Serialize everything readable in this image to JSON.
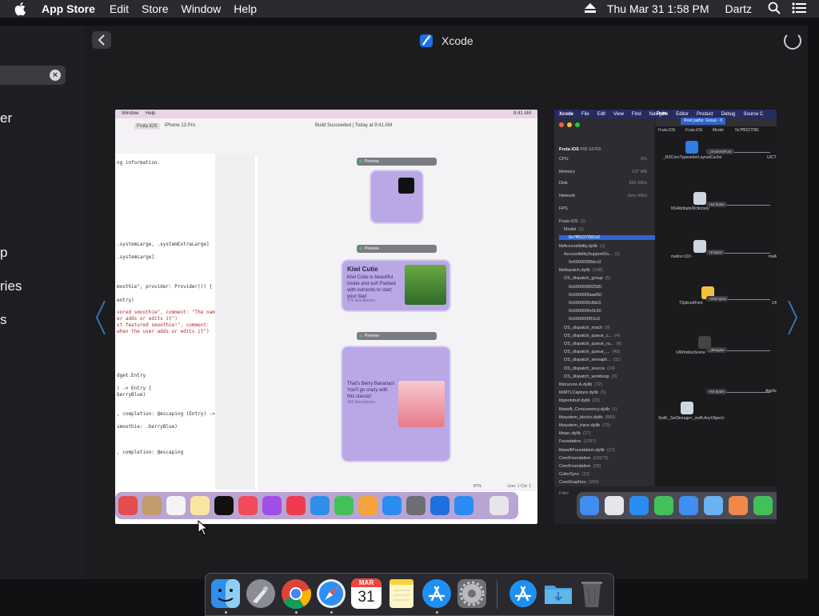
{
  "menubar": {
    "app_name": "App Store",
    "menus": [
      "Edit",
      "Store",
      "Window",
      "Help"
    ],
    "datetime": "Thu Mar 31  1:58 PM",
    "user": "Dartz",
    "icons": [
      "apple-icon",
      "eject-icon",
      "search-icon",
      "control-center-icon"
    ]
  },
  "sidebar": {
    "fragments": [
      "er",
      "p",
      "ries",
      "s"
    ]
  },
  "window": {
    "title": "Xcode"
  },
  "card1": {
    "menu_items": [
      "Window",
      "Help"
    ],
    "time": "9:41 AM",
    "breadcrumb": [
      "Fruta iOS",
      "iPhone 13 Pro"
    ],
    "build_status": "Build Succeeded | Today at 9:41 AM",
    "code_lines": [
      "ng information.",
      ".systemLarge, .systemExtraLarge]",
      ".systemLarge]",
      "moothie\", provider: Provider()) {",
      "entry)",
      "vored smoothie\", comment: \"The name",
      "er adds or edits it\")",
      "st featured smoothie!\", comment:",
      "when the user adds or edits it\")",
      "dget.Entry",
      ") -> Entry {",
      "berryBlue)",
      ", completion: @escaping (Entry) ->",
      "smoothie: .berryBlue)",
      ", completion: @escaping"
    ],
    "preview_label": "Preview",
    "widgets": [
      {
        "title": "Kiwi Cutie",
        "desc": "Kiwi Cutie is beautiful inside and out! Packed with nutrients to start your day!",
        "cal": "170 kilocalories"
      },
      {
        "title": "",
        "desc": "That's Berry Bananas! You'll go crazy with this classic!",
        "cal": "150 kilocalories"
      }
    ],
    "zoom": "87%",
    "cursor_pos": "Line: 1  Col: 1"
  },
  "card2": {
    "menu_items": [
      "Xcode",
      "File",
      "Edit",
      "View",
      "Find",
      "Navigate",
      "Editor",
      "Product",
      "Debug",
      "Source C"
    ],
    "scheme": "Fruta",
    "scheme_sub": "Fruta",
    "tab": "Root paths: Group - 0",
    "path": [
      "Fruta iOS",
      "Fruta iOS",
      "Model",
      "0x7ff5227081"
    ],
    "process": {
      "name": "Fruta iOS",
      "pid": "PID 14769"
    },
    "gauges": [
      {
        "name": "CPU",
        "value": "0%"
      },
      {
        "name": "Memory",
        "value": "137 MB"
      },
      {
        "name": "Disk",
        "value": "562 KB/s"
      },
      {
        "name": "Network",
        "value": "Zero KB/s"
      },
      {
        "name": "FPS",
        "value": ""
      }
    ],
    "tree": [
      {
        "label": "Fruta iOS",
        "count": "(1)"
      },
      {
        "label": "Model",
        "count": "(1)"
      },
      {
        "label": "0x7ff5227081b0",
        "count": ""
      },
      {
        "label": "libAccessibility.dylib",
        "count": "(1)"
      },
      {
        "label": "AccessibilitySupportOv...",
        "count": "(1)"
      },
      {
        "label": "0x600000f8dcc0",
        "count": ""
      },
      {
        "label": "libdispatch.dylib",
        "count": "(108)"
      },
      {
        "label": "OS_dispatch_group",
        "count": "(5)"
      },
      {
        "label": "0x600000f82580",
        "count": ""
      },
      {
        "label": "0x600000faad50",
        "count": ""
      },
      {
        "label": "0x600000fc8dc0",
        "count": ""
      },
      {
        "label": "0x600000fe0c30",
        "count": ""
      },
      {
        "label": "0x600000ff15c0",
        "count": ""
      },
      {
        "label": "OS_dispatch_mach",
        "count": "(9)"
      },
      {
        "label": "OS_dispatch_queue_c...",
        "count": "(4)"
      },
      {
        "label": "OS_dispatch_queue_ru...",
        "count": "(8)"
      },
      {
        "label": "OS_dispatch_queue_...",
        "count": "(48)"
      },
      {
        "label": "OS_dispatch_semaph...",
        "count": "(11)"
      },
      {
        "label": "OS_dispatch_source",
        "count": "(24)"
      },
      {
        "label": "OS_dispatch_workloop",
        "count": "(3)"
      },
      {
        "label": "libicucore.A.dylib",
        "count": "(72)"
      },
      {
        "label": "libMTLCapture.dylib",
        "count": "(5)"
      },
      {
        "label": "libprotobuf.dylib",
        "count": "(23)"
      },
      {
        "label": "libswift_Concurrency.dylib",
        "count": "(1)"
      },
      {
        "label": "libsystem_blocks.dylib",
        "count": "(880)"
      },
      {
        "label": "libsystem_trace.dylib",
        "count": "(73)"
      },
      {
        "label": "libxpc.dylib",
        "count": "(27)"
      },
      {
        "label": "Foundation",
        "count": "(1257)"
      },
      {
        "label": "libswiftFoundation.dylib",
        "count": "(17)"
      },
      {
        "label": "CoreFoundation",
        "count": "(12673)"
      },
      {
        "label": "CoreFoundation",
        "count": "(28)"
      },
      {
        "label": "ColorSync",
        "count": "(12)"
      },
      {
        "label": "CoreGraphics",
        "count": "(260)"
      }
    ],
    "filter_placeholder": "Filter",
    "graph_nodes": [
      "_NSCoreTypesetterLayoutCache",
      "UICT",
      "NSAttributeDictionary",
      "malloc<32>",
      "mallo",
      "TSplicedFont",
      "UICTFontD",
      "UIWindowScene",
      "AppScene",
      "Swift._SetStorage<_swift.AnyObject>"
    ],
    "graph_edges": [
      "_resolvedFont",
      "+64 bytes",
      "+8 bytes",
      "+608 bytes",
      "_delegate",
      "+64 bytes"
    ]
  },
  "dock": {
    "apps": [
      {
        "name": "Finder",
        "icon": "finder-icon",
        "running": true
      },
      {
        "name": "Launchpad",
        "icon": "launchpad-icon",
        "running": false
      },
      {
        "name": "Google Chrome",
        "icon": "chrome-icon",
        "running": true
      },
      {
        "name": "Safari",
        "icon": "safari-icon",
        "running": true
      },
      {
        "name": "Calendar",
        "icon": "calendar-icon",
        "running": false
      },
      {
        "name": "Notes",
        "icon": "notes-icon",
        "running": false
      },
      {
        "name": "App Store",
        "icon": "app-store-icon",
        "running": true
      },
      {
        "name": "System Preferences",
        "icon": "system-preferences-icon",
        "running": false
      }
    ],
    "calendar_month": "MAR",
    "calendar_day": "31",
    "extras": [
      {
        "name": "Applications",
        "icon": "app-store-folder-icon"
      },
      {
        "name": "Downloads",
        "icon": "downloads-folder-icon"
      },
      {
        "name": "Trash",
        "icon": "trash-icon"
      }
    ]
  },
  "colors": {
    "menubar_bg": "#2b2b2f",
    "window_bg": "#1c1c1f",
    "widget_purple": "#b9a7e6",
    "selection_blue": "#2f65d6",
    "preview_chevron": "#3d6fb0"
  }
}
